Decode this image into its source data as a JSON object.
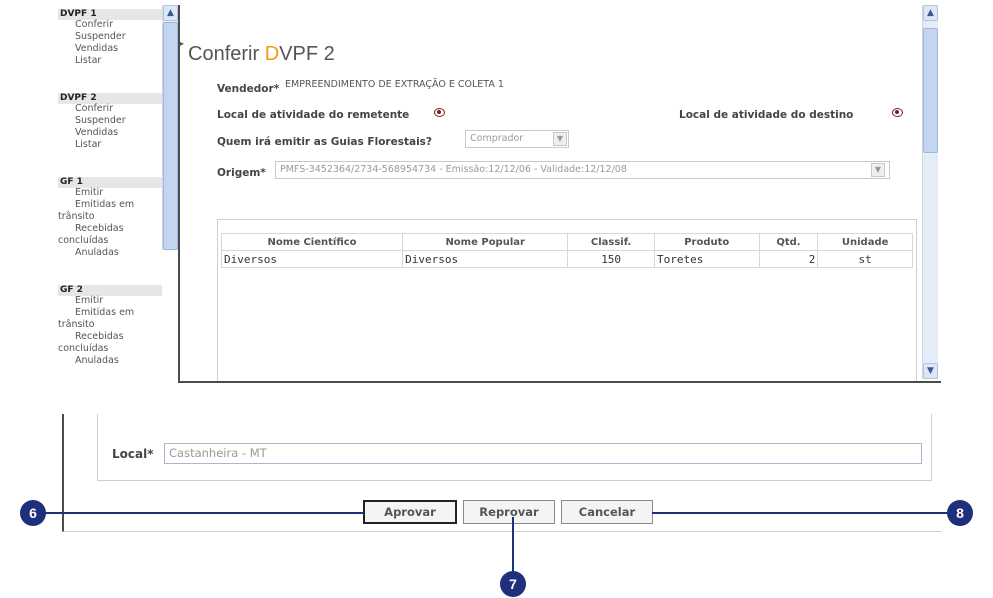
{
  "sidebar": {
    "sections": [
      {
        "title": "DVPF 1",
        "items": [
          "Conferir",
          "Suspender",
          "Vendidas",
          "Listar"
        ]
      },
      {
        "title": "DVPF 2",
        "items": [
          "Conferir",
          "Suspender",
          "Vendidas",
          "Listar"
        ]
      },
      {
        "title": "GF 1",
        "items": [
          "Emitir",
          "Emitidas em",
          "trânsito",
          "Recebidas",
          "concluídas",
          "Anuladas"
        ]
      },
      {
        "title": "GF 2",
        "items": [
          "Emitir",
          "Emitidas em",
          "trânsito",
          "Recebidas",
          "concluídas",
          "Anuladas"
        ]
      }
    ]
  },
  "page": {
    "title_prefix": "Conferir ",
    "title_letter": "D",
    "title_rest": "VPF 2",
    "accent_color": "#f39c12"
  },
  "form": {
    "vendedor_label": "Vendedor*",
    "vendedor_value": "EMPREENDIMENTO DE EXTRAÇÃO E COLETA 1",
    "local_remetente_label": "Local de atividade do remetente",
    "local_destino_label": "Local de atividade do destino",
    "guias_label": "Quem irá emitir as Guias Florestais?",
    "guias_value": "Comprador",
    "origem_label": "Origem*",
    "origem_value": "PMFS-3452364/2734-568954734 - Emissão:12/12/06 - Validade:12/12/08"
  },
  "table": {
    "headers": [
      "Nome Científico",
      "Nome Popular",
      "Classif.",
      "Produto",
      "Qtd.",
      "Unidade"
    ],
    "rows": [
      [
        "Diversos",
        "Diversos",
        "150",
        "Toretes",
        "2",
        "st"
      ]
    ]
  },
  "lower": {
    "local_label": "Local*",
    "local_value": "Castanheira - MT"
  },
  "buttons": {
    "approve": "Aprovar",
    "reject": "Reprovar",
    "cancel": "Cancelar"
  },
  "callouts": {
    "approve": "6",
    "reject": "7",
    "cancel": "8"
  }
}
